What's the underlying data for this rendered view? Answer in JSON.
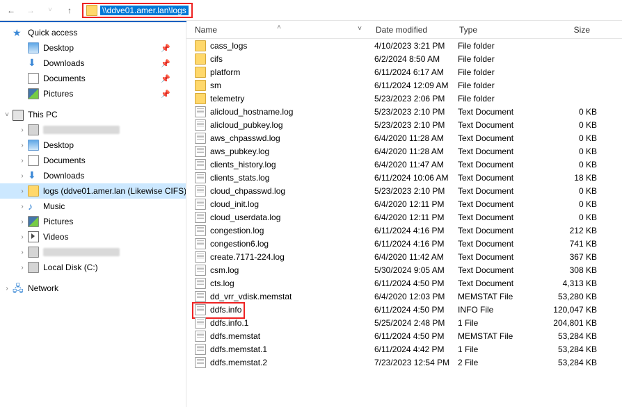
{
  "address": {
    "path": "\\\\ddve01.amer.lan\\logs"
  },
  "sidebar": {
    "quick_access": "Quick access",
    "qa": [
      "Desktop",
      "Downloads",
      "Documents",
      "Pictures"
    ],
    "this_pc": "This PC",
    "pc_items": [
      {
        "label": "",
        "blur": true
      },
      {
        "label": "Desktop"
      },
      {
        "label": "Documents"
      },
      {
        "label": "Downloads"
      },
      {
        "label": "logs (ddve01.amer.lan (Likewise CIFS))",
        "sel": true
      },
      {
        "label": "Music"
      },
      {
        "label": "Pictures"
      },
      {
        "label": "Videos"
      },
      {
        "label": "",
        "blur": true
      },
      {
        "label": "Local Disk (C:)"
      }
    ],
    "network": "Network"
  },
  "columns": {
    "name": "Name",
    "date": "Date modified",
    "type": "Type",
    "size": "Size"
  },
  "files": [
    {
      "name": "cass_logs",
      "date": "4/10/2023 3:21 PM",
      "type": "File folder",
      "size": "",
      "folder": true
    },
    {
      "name": "cifs",
      "date": "6/2/2024 8:50 AM",
      "type": "File folder",
      "size": "",
      "folder": true
    },
    {
      "name": "platform",
      "date": "6/11/2024 6:17 AM",
      "type": "File folder",
      "size": "",
      "folder": true
    },
    {
      "name": "sm",
      "date": "6/11/2024 12:09 AM",
      "type": "File folder",
      "size": "",
      "folder": true
    },
    {
      "name": "telemetry",
      "date": "5/23/2023 2:06 PM",
      "type": "File folder",
      "size": "",
      "folder": true
    },
    {
      "name": "alicloud_hostname.log",
      "date": "5/23/2023 2:10 PM",
      "type": "Text Document",
      "size": "0 KB"
    },
    {
      "name": "alicloud_pubkey.log",
      "date": "5/23/2023 2:10 PM",
      "type": "Text Document",
      "size": "0 KB"
    },
    {
      "name": "aws_chpasswd.log",
      "date": "6/4/2020 11:28 AM",
      "type": "Text Document",
      "size": "0 KB"
    },
    {
      "name": "aws_pubkey.log",
      "date": "6/4/2020 11:28 AM",
      "type": "Text Document",
      "size": "0 KB"
    },
    {
      "name": "clients_history.log",
      "date": "6/4/2020 11:47 AM",
      "type": "Text Document",
      "size": "0 KB"
    },
    {
      "name": "clients_stats.log",
      "date": "6/11/2024 10:06 AM",
      "type": "Text Document",
      "size": "18 KB"
    },
    {
      "name": "cloud_chpasswd.log",
      "date": "5/23/2023 2:10 PM",
      "type": "Text Document",
      "size": "0 KB"
    },
    {
      "name": "cloud_init.log",
      "date": "6/4/2020 12:11 PM",
      "type": "Text Document",
      "size": "0 KB"
    },
    {
      "name": "cloud_userdata.log",
      "date": "6/4/2020 12:11 PM",
      "type": "Text Document",
      "size": "0 KB"
    },
    {
      "name": "congestion.log",
      "date": "6/11/2024 4:16 PM",
      "type": "Text Document",
      "size": "212 KB"
    },
    {
      "name": "congestion6.log",
      "date": "6/11/2024 4:16 PM",
      "type": "Text Document",
      "size": "741 KB"
    },
    {
      "name": "create.7171-224.log",
      "date": "6/4/2020 11:42 AM",
      "type": "Text Document",
      "size": "367 KB"
    },
    {
      "name": "csm.log",
      "date": "5/30/2024 9:05 AM",
      "type": "Text Document",
      "size": "308 KB"
    },
    {
      "name": "cts.log",
      "date": "6/11/2024 4:50 PM",
      "type": "Text Document",
      "size": "4,313 KB"
    },
    {
      "name": "dd_vrr_vdisk.memstat",
      "date": "6/4/2020 12:03 PM",
      "type": "MEMSTAT File",
      "size": "53,280 KB"
    },
    {
      "name": "ddfs.info",
      "date": "6/11/2024 4:50 PM",
      "type": "INFO File",
      "size": "120,047 KB",
      "hl": true
    },
    {
      "name": "ddfs.info.1",
      "date": "5/25/2024 2:48 PM",
      "type": "1 File",
      "size": "204,801 KB"
    },
    {
      "name": "ddfs.memstat",
      "date": "6/11/2024 4:50 PM",
      "type": "MEMSTAT File",
      "size": "53,284 KB"
    },
    {
      "name": "ddfs.memstat.1",
      "date": "6/11/2024 4:42 PM",
      "type": "1 File",
      "size": "53,284 KB"
    },
    {
      "name": "ddfs.memstat.2",
      "date": "7/23/2023 12:54 PM",
      "type": "2 File",
      "size": "53,284 KB"
    }
  ]
}
